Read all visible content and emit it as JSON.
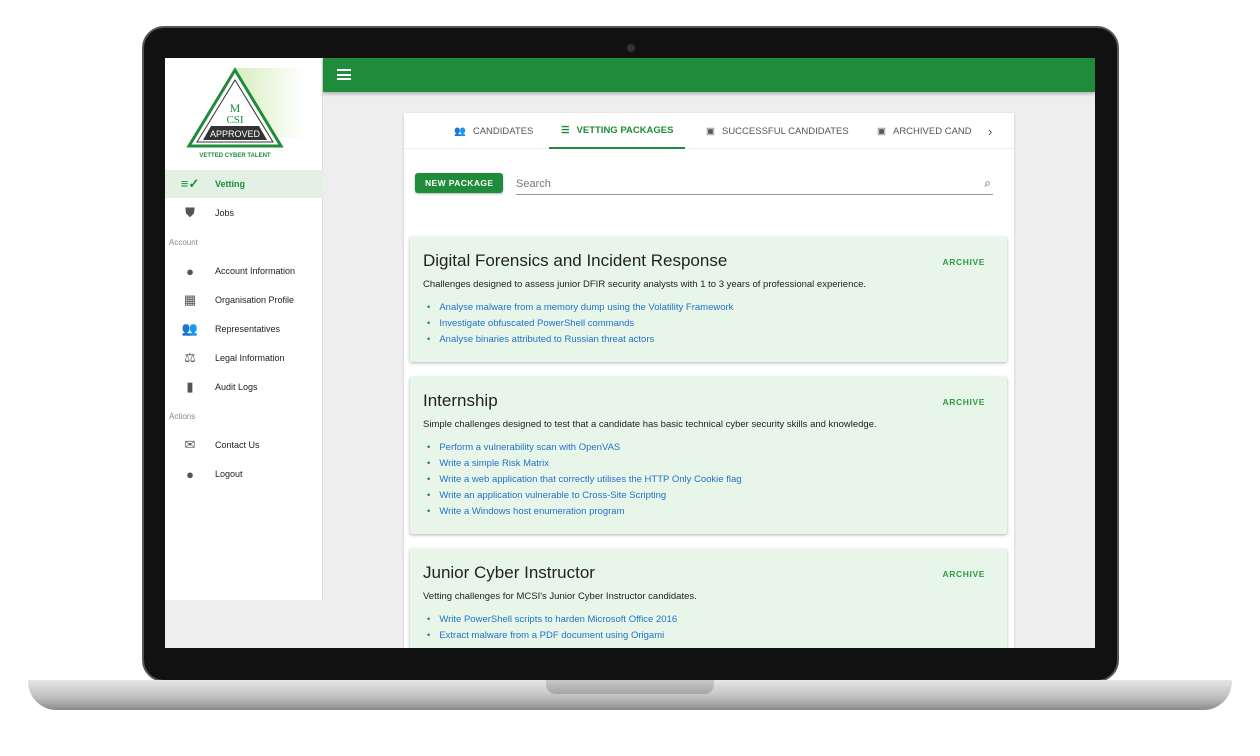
{
  "logo": {
    "top": "M\nCSI",
    "badge": "APPROVED",
    "tagline": "VETTED CYBER TALENT"
  },
  "sidebar": {
    "items": [
      {
        "label": "Vetting",
        "icon": "checklist-icon"
      },
      {
        "label": "Jobs",
        "icon": "shield-person-icon"
      }
    ],
    "account_label": "Account",
    "account": [
      {
        "label": "Account Information",
        "icon": "account-circle-icon"
      },
      {
        "label": "Organisation Profile",
        "icon": "building-icon"
      },
      {
        "label": "Representatives",
        "icon": "people-icon"
      },
      {
        "label": "Legal Information",
        "icon": "scales-icon"
      },
      {
        "label": "Audit Logs",
        "icon": "document-icon"
      }
    ],
    "actions_label": "Actions",
    "actions": [
      {
        "label": "Contact Us",
        "icon": "mail-icon"
      },
      {
        "label": "Logout",
        "icon": "account-circle-icon"
      }
    ]
  },
  "tabs": [
    {
      "label": "CANDIDATES",
      "icon": "group-icon"
    },
    {
      "label": "VETTING PACKAGES",
      "icon": "list-icon",
      "active": true
    },
    {
      "label": "SUCCESSFUL CANDIDATES",
      "icon": "archive-box-icon"
    },
    {
      "label": "ARCHIVED CAND",
      "icon": "archive-box-icon"
    }
  ],
  "toolbar": {
    "new_package": "NEW PACKAGE",
    "search_placeholder": "Search"
  },
  "packages": [
    {
      "title": "Digital Forensics and Incident Response",
      "description": "Challenges designed to assess junior DFIR security analysts with 1 to 3 years of professional experience.",
      "archive": "ARCHIVE",
      "items": [
        "Analyse malware from a memory dump using the Volatility Framework",
        "Investigate obfuscated PowerShell commands",
        "Analyse binaries attributed to Russian threat actors"
      ]
    },
    {
      "title": "Internship",
      "description": "Simple challenges designed to test that a candidate has basic technical cyber security skills and knowledge.",
      "archive": "ARCHIVE",
      "items": [
        "Perform a vulnerability scan with OpenVAS",
        "Write a simple Risk Matrix",
        "Write a web application that correctly utilises the HTTP Only Cookie flag",
        "Write an application vulnerable to Cross-Site Scripting",
        "Write a Windows host enumeration program"
      ]
    },
    {
      "title": "Junior Cyber Instructor",
      "description": "Vetting challenges for MCSI's Junior Cyber Instructor candidates.",
      "archive": "ARCHIVE",
      "items": [
        "Write PowerShell scripts to harden Microsoft Office 2016",
        "Extract malware from a PDF document using Origami"
      ]
    }
  ],
  "colors": {
    "brand": "#1e8c3a",
    "card": "#e8f5e9",
    "link": "#1f73c8"
  }
}
